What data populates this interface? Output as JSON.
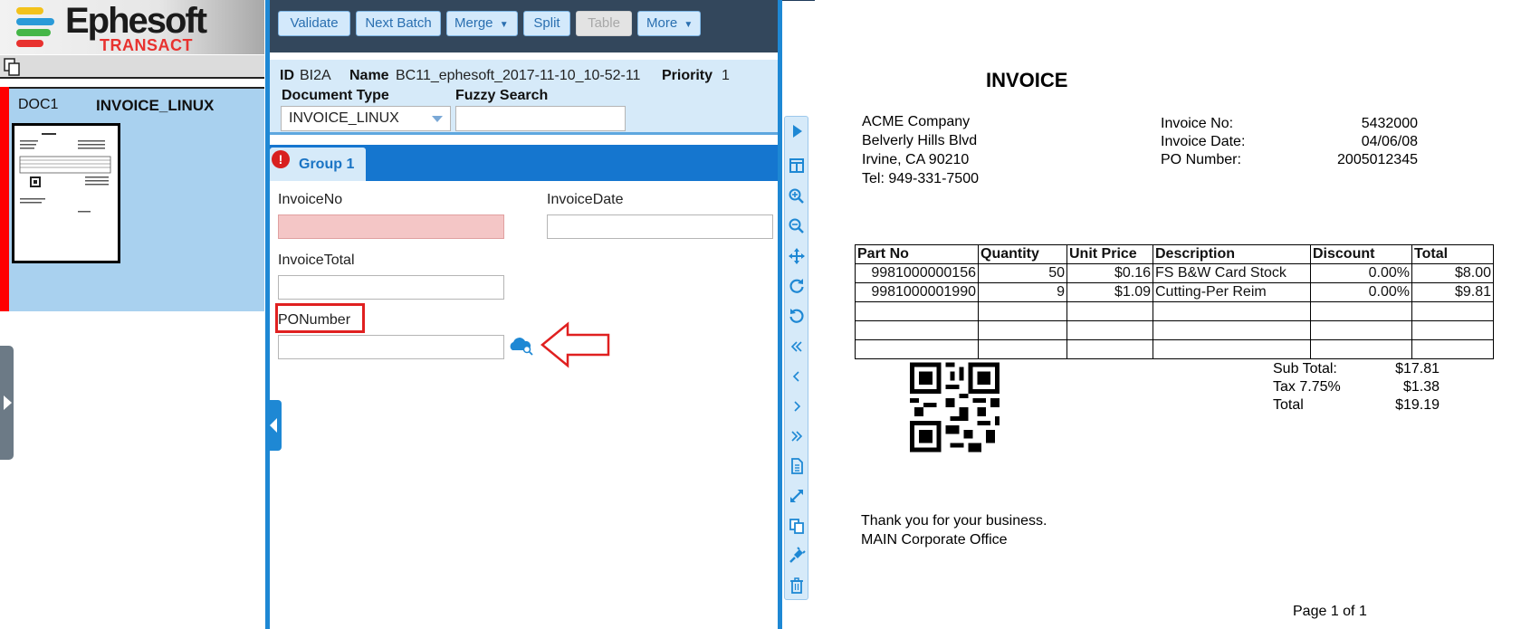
{
  "logo": {
    "brand": "Ephesoft",
    "product": "TRANSACT"
  },
  "doc_list": {
    "doc_id": "DOC1",
    "doc_type": "INVOICE_LINUX"
  },
  "toolbar": {
    "buttons": [
      {
        "label": "Validate"
      },
      {
        "label": "Next Batch"
      },
      {
        "label": "Merge",
        "dropdown": true
      },
      {
        "label": "Split"
      },
      {
        "label": "Table",
        "disabled": true
      },
      {
        "label": "More",
        "dropdown": true
      }
    ]
  },
  "batch_info": {
    "id_label": "ID",
    "id_value": "BI2A",
    "name_label": "Name",
    "name_value": "BC11_ephesoft_2017-11-10_10-52-11",
    "priority_label": "Priority",
    "priority_value": "1",
    "doc_type_label": "Document Type",
    "doc_type_value": "INVOICE_LINUX",
    "fuzzy_label": "Fuzzy Search"
  },
  "group_tab": {
    "label": "Group 1",
    "error_icon": "!"
  },
  "fields": {
    "invoice_no": {
      "label": "InvoiceNo",
      "value": ""
    },
    "invoice_date": {
      "label": "InvoiceDate",
      "value": ""
    },
    "invoice_total": {
      "label": "InvoiceTotal",
      "value": ""
    },
    "po_number": {
      "label": "PONumber",
      "value": ""
    }
  },
  "invoice_doc": {
    "title": "INVOICE",
    "company": [
      "ACME Company",
      "Belverly Hills Blvd",
      "Irvine, CA 90210",
      "Tel: 949-331-7500"
    ],
    "meta_labels": [
      "Invoice No:",
      "Invoice Date:",
      "PO Number:"
    ],
    "meta_values": [
      "5432000",
      "04/06/08",
      "2005012345"
    ],
    "table_headers": [
      "Part No",
      "Quantity",
      "Unit Price",
      "Description",
      "Discount",
      "Total"
    ],
    "rows": [
      [
        "9981000000156",
        "50",
        "$0.16",
        "FS B&W Card Stock",
        "0.00%",
        "$8.00"
      ],
      [
        "9981000001990",
        "9",
        "$1.09",
        "Cutting-Per Reim",
        "0.00%",
        "$9.81"
      ]
    ],
    "totals_labels": [
      "Sub Total:",
      "Tax 7.75%",
      "Total"
    ],
    "totals_values": [
      "$17.81",
      "$1.38",
      "$19.19"
    ],
    "footer": [
      "Thank you for your business.",
      "MAIN Corporate Office"
    ],
    "page": "Page 1 of 1"
  }
}
